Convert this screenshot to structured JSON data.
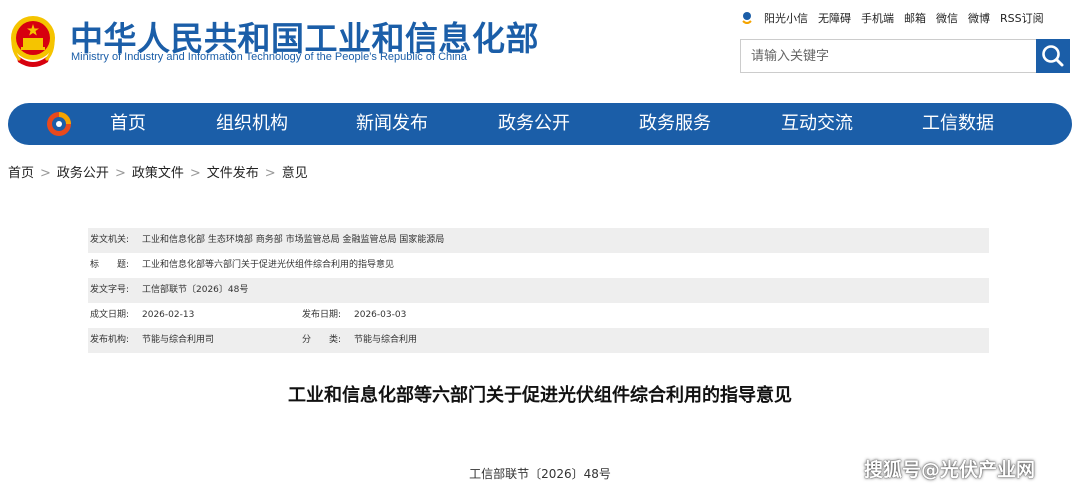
{
  "header": {
    "title": "中华人民共和国工业和信息化部",
    "subtitle": "Ministry of Industry and Information Technology of the People’s Republic of China",
    "emblem_icon": "national-emblem-icon"
  },
  "toplinks": [
    "阳光小信",
    "无障碍",
    "手机端",
    "邮箱",
    "微信",
    "微博",
    "RSS订阅"
  ],
  "search": {
    "placeholder": "请输入关键字",
    "icon": "search-icon"
  },
  "nav": {
    "logo_icon": "miit-logo-icon",
    "items": [
      "首页",
      "组织机构",
      "新闻发布",
      "政务公开",
      "政务服务",
      "互动交流",
      "工信数据"
    ]
  },
  "breadcrumb": [
    "首页",
    "政务公开",
    "政策文件",
    "文件发布",
    "意见"
  ],
  "meta": {
    "issuer_label": "发文机关:",
    "issuer": "工业和信息化部 生态环境部 商务部 市场监管总局 金融监管总局 国家能源局",
    "title_label": "标　　题:",
    "title": "工业和信息化部等六部门关于促进光伏组件综合利用的指导意见",
    "docno_label": "发文字号:",
    "docno": "工信部联节〔2026〕48号",
    "created_label": "成文日期:",
    "created": "2026-02-13",
    "published_label": "发布日期:",
    "published": "2026-03-03",
    "org_label": "发布机构:",
    "org": "节能与综合利用司",
    "category_label": "分　　类:",
    "category": "节能与综合利用"
  },
  "document": {
    "title": "工业和信息化部等六部门关于促进光伏组件综合利用的指导意见",
    "number": "工信部联节〔2026〕48号"
  },
  "watermark": "搜狐号@光伏产业网",
  "colors": {
    "brand_blue": "#1b5ea8",
    "meta_shade": "#eeeeee",
    "emblem_red": "#d7000f",
    "emblem_gold": "#f5c400"
  }
}
